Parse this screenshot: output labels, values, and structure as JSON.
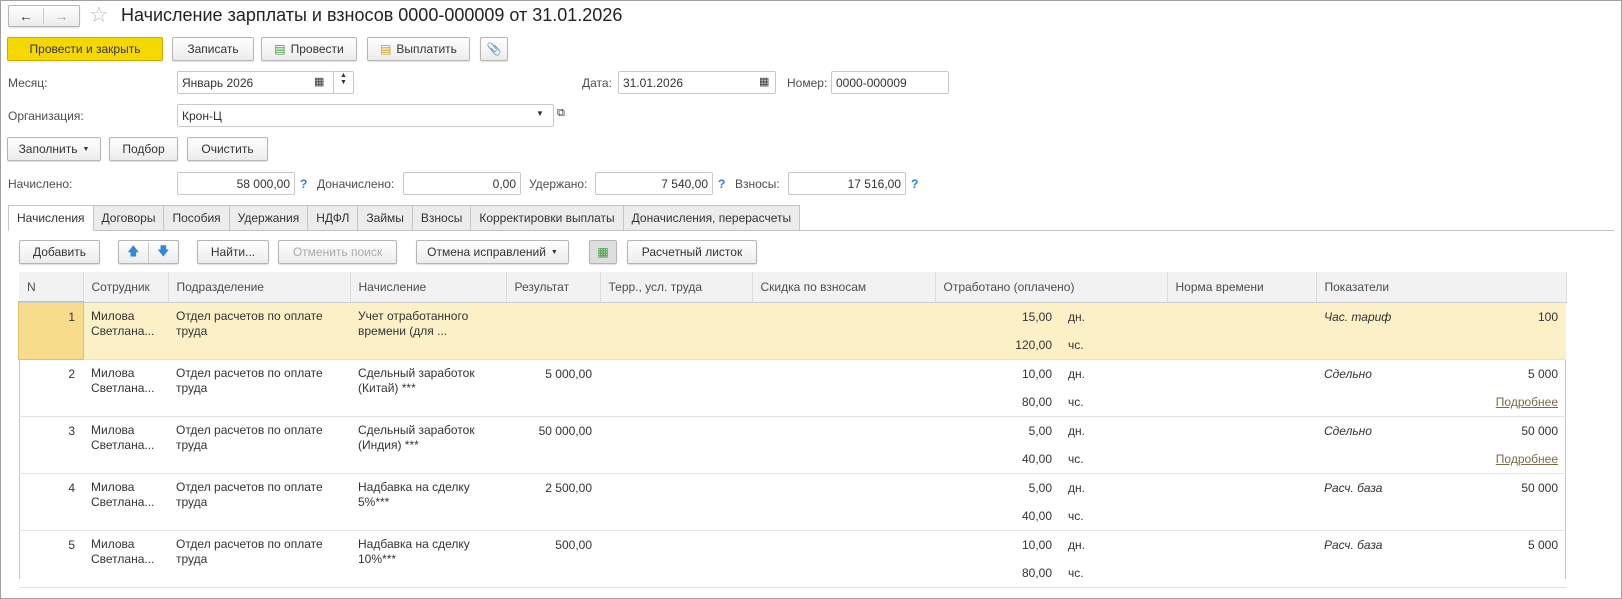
{
  "header": {
    "title": "Начисление зарплаты и взносов 0000-000009 от 31.01.2026"
  },
  "toolbar": {
    "post_close": "Провести и закрыть",
    "save": "Записать",
    "post": "Провести",
    "pay": "Выплатить"
  },
  "form": {
    "month_label": "Месяц:",
    "month_value": "Январь 2026",
    "date_label": "Дата:",
    "date_value": "31.01.2026",
    "number_label": "Номер:",
    "number_value": "0000-000009",
    "org_label": "Организация:",
    "org_value": "Крон-Ц",
    "fill": "Заполнить",
    "pick": "Подбор",
    "clear": "Очистить",
    "accrued_label": "Начислено:",
    "accrued": "58 000,00",
    "extra_label": "Доначислено:",
    "extra": "0,00",
    "withheld_label": "Удержано:",
    "withheld": "7 540,00",
    "contrib_label": "Взносы:",
    "contrib": "17 516,00",
    "help": "?"
  },
  "tabs": [
    "Начисления",
    "Договоры",
    "Пособия",
    "Удержания",
    "НДФЛ",
    "Займы",
    "Взносы",
    "Корректировки выплаты",
    "Доначисления, перерасчеты"
  ],
  "grid_toolbar": {
    "add": "Добавить",
    "find": "Найти...",
    "cancel_search": "Отменить поиск",
    "undo_fixes": "Отмена исправлений",
    "payslip": "Расчетный листок"
  },
  "columns": [
    "N",
    "Сотрудник",
    "Подразделение",
    "Начисление",
    "Результат",
    "Терр., усл. труда",
    "Скидка по взносам",
    "Отработано (оплачено)",
    "Норма времени",
    "Показатели"
  ],
  "rows": [
    {
      "n": "1",
      "employee": "Милова Светлана...",
      "dept": "Отдел расчетов по оплате труда",
      "accrual": "Учет отработанного времени (для ...",
      "result": "",
      "days": "15,00",
      "days_unit": "дн.",
      "hours": "120,00",
      "hours_unit": "чс.",
      "indicator": "Час. тариф",
      "indicator_value": "100",
      "more": ""
    },
    {
      "n": "2",
      "employee": "Милова Светлана...",
      "dept": "Отдел расчетов по оплате труда",
      "accrual": "Сдельный заработок (Китай) ***",
      "result": "5 000,00",
      "days": "10,00",
      "days_unit": "дн.",
      "hours": "80,00",
      "hours_unit": "чс.",
      "indicator": "Сдельно",
      "indicator_value": "5 000",
      "more": "Подробнее"
    },
    {
      "n": "3",
      "employee": "Милова Светлана...",
      "dept": "Отдел расчетов по оплате труда",
      "accrual": "Сдельный заработок (Индия) ***",
      "result": "50 000,00",
      "days": "5,00",
      "days_unit": "дн.",
      "hours": "40,00",
      "hours_unit": "чс.",
      "indicator": "Сдельно",
      "indicator_value": "50 000",
      "more": "Подробнее"
    },
    {
      "n": "4",
      "employee": "Милова Светлана...",
      "dept": "Отдел расчетов по оплате труда",
      "accrual": "Надбавка на сделку 5%***",
      "result": "2 500,00",
      "days": "5,00",
      "days_unit": "дн.",
      "hours": "40,00",
      "hours_unit": "чс.",
      "indicator": "Расч. база",
      "indicator_value": "50 000",
      "more": ""
    },
    {
      "n": "5",
      "employee": "Милова Светлана...",
      "dept": "Отдел расчетов по оплате труда",
      "accrual": "Надбавка на сделку 10%***",
      "result": "500,00",
      "days": "10,00",
      "days_unit": "дн.",
      "hours": "80,00",
      "hours_unit": "чс.",
      "indicator": "Расч. база",
      "indicator_value": "5 000",
      "more": ""
    }
  ]
}
